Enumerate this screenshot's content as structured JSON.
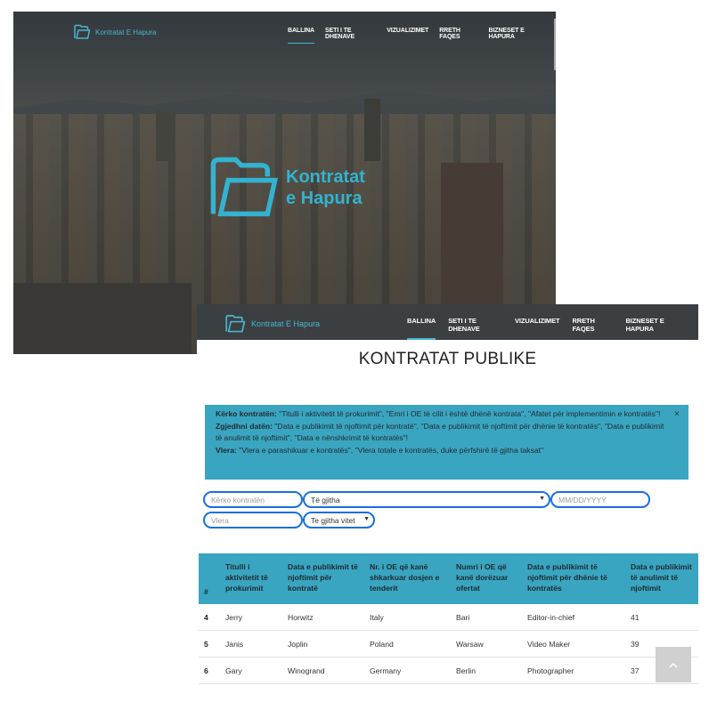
{
  "brand": {
    "name": "Kontratat E Hapura",
    "hero_line1": "Kontratat",
    "hero_line2": "e Hapura"
  },
  "nav": {
    "items": [
      "BALLINA",
      "SETI I TE DHENAVE",
      "VIZUALIZIMET",
      "RRETH FAQES",
      "BIZNESET E HAPURA"
    ],
    "active": "BALLINA"
  },
  "page": {
    "title": "KONTRATAT PUBLIKE"
  },
  "info": {
    "search_label": "Kërko kontratën:",
    "search_text": " \"Titulli i aktivitetit të prokurimit\", \"Emri i OE të cilit i është dhënë kontrata\", \"Afatet për implementimin e kontratës\"!",
    "date_label": "Zgjedhni datën:",
    "date_text": " \"Data e publikimit të njoftimit për kontratë\", \"Data e publikimit të njoftimit për dhënie të kontratës\", \"Data e publikimit të anulimit të njoftimit\", \"Data e nënshkrimit të kontratës\"!",
    "value_label": "Vlera:",
    "value_text": " \"Vlera e parashikuar e kontratës\", \"Vlera totale e kontratës, duke përfshirë të gjitha taksat\"",
    "close": "×"
  },
  "filters": {
    "search_placeholder": "Kërko kontratën",
    "category_value": "Të gjitha",
    "date_placeholder": "MM/DD/YYYY",
    "value_placeholder": "Vlera",
    "year_value": "Te gjitha vitet"
  },
  "table": {
    "headers": [
      "#",
      "Titulli i aktivitetit të prokurimit",
      "Data e publikimit të njoftimit për kontratë",
      "Nr. i OE që kanë shkarkuar dosjen e tenderit",
      "Numri i OE që kanë dorëzuar ofertat",
      "Data e publikimit të njoftimit për dhënie të kontratës",
      "Data e publikimit të anulimit të njoftimit"
    ],
    "rows": [
      [
        "4",
        "Jerry",
        "Horwitz",
        "Italy",
        "Bari",
        "Editor-in-chief",
        "41"
      ],
      [
        "5",
        "Janis",
        "Joplin",
        "Poland",
        "Warsaw",
        "Video Maker",
        "39"
      ],
      [
        "6",
        "Gary",
        "Winogrand",
        "Germany",
        "Berlin",
        "Photographer",
        "37"
      ]
    ]
  },
  "icons": {
    "logo": "folder-logo-icon",
    "back_to_top": "chevron-up-icon",
    "select_caret": "caret-down-icon",
    "close": "close-icon"
  },
  "colors": {
    "accent": "#3aa5c0",
    "logo": "#4ab5cf",
    "nav_bg": "#3b3f42",
    "input_border": "#1a6fe0"
  }
}
